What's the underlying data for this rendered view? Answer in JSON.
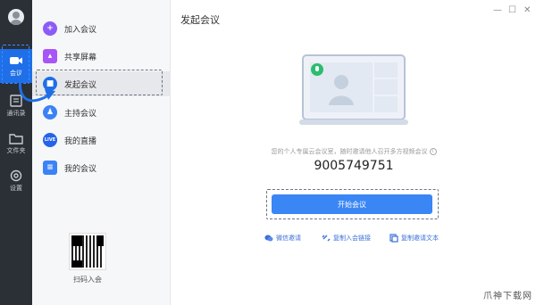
{
  "rail": {
    "items": [
      {
        "label": "会议"
      },
      {
        "label": "通讯录"
      },
      {
        "label": "文件夹"
      },
      {
        "label": "设置"
      }
    ]
  },
  "menu": {
    "items": [
      {
        "label": "加入会议",
        "icon": "plus-icon",
        "color": "#8b5cf6"
      },
      {
        "label": "共享屏幕",
        "icon": "screen-share-icon",
        "color": "#a855f7"
      },
      {
        "label": "发起会议",
        "icon": "video-camera-icon",
        "color": "#1f6fe8"
      },
      {
        "label": "主持会议",
        "icon": "host-icon",
        "color": "#3b82f6"
      },
      {
        "label": "我的直播",
        "icon": "live-icon",
        "color": "#2563eb"
      },
      {
        "label": "我的会议",
        "icon": "meetings-list-icon",
        "color": "#3b82f6"
      }
    ],
    "qr_label": "扫码入会"
  },
  "main": {
    "title": "发起会议",
    "hint": "您的个人专属云会议室，随时邀请他人召开多方视频会议",
    "meeting_id": "9005749751",
    "start_button": "开始会议",
    "share_options": [
      {
        "label": "微信邀请",
        "icon": "wechat-icon"
      },
      {
        "label": "复制入会链接",
        "icon": "link-icon"
      },
      {
        "label": "复制邀请文本",
        "icon": "copy-text-icon"
      }
    ]
  },
  "window_controls": {
    "minimize": "—",
    "maximize": "☐",
    "close": "✕"
  },
  "watermark": "爪神下载网",
  "colors": {
    "accent": "#1f6fe8",
    "rail_bg": "#2b2f36",
    "button": "#3a86f5",
    "mic_green": "#2bbd6e"
  }
}
